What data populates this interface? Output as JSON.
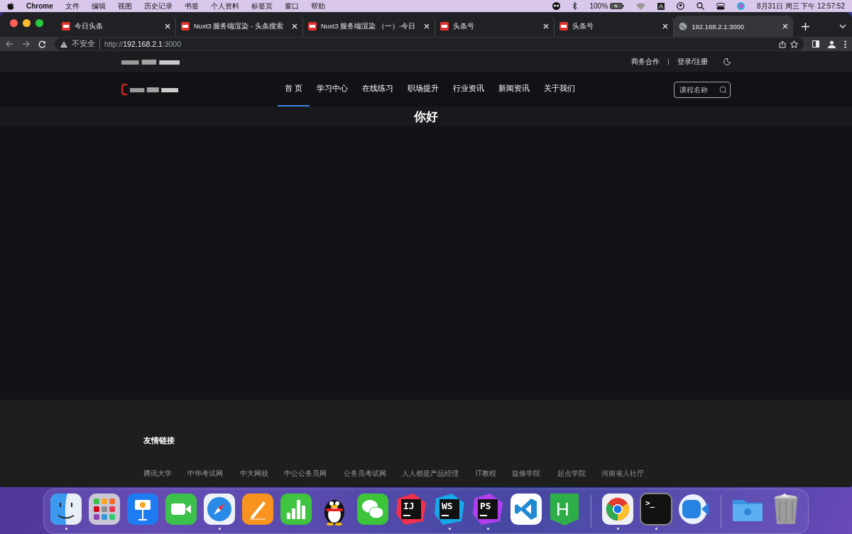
{
  "menu_bar": {
    "app": "Chrome",
    "menus": [
      "文件",
      "编辑",
      "视图",
      "历史记录",
      "书签",
      "个人资料",
      "标签页",
      "窗口",
      "帮助"
    ],
    "battery": "100%",
    "input_method": "A",
    "clock": "8月31日 周三 下午 12:57:52"
  },
  "tabs": [
    {
      "title": "今日头条",
      "kind": "site",
      "selected": false
    },
    {
      "title": "Nuxt3 服务端渲染 - 头条搜索",
      "kind": "site",
      "selected": false
    },
    {
      "title": "Nuxt3 服务端渲染 （一）-今日",
      "kind": "site",
      "selected": false
    },
    {
      "title": "头条号",
      "kind": "site",
      "selected": false
    },
    {
      "title": "头条号",
      "kind": "site",
      "selected": false
    },
    {
      "title": "192.168.2.1:3000",
      "kind": "local",
      "selected": true
    }
  ],
  "address_bar": {
    "security": "不安全",
    "scheme": "http://",
    "host": "192.168.2.1",
    "port": ":3000"
  },
  "site": {
    "top_links": [
      "商务合作",
      "登录/注册"
    ],
    "nav": [
      {
        "label": "首 页",
        "selected": true
      },
      {
        "label": "学习中心",
        "selected": false
      },
      {
        "label": "在线练习",
        "selected": false
      },
      {
        "label": "职场提升",
        "selected": false
      },
      {
        "label": "行业资讯",
        "selected": false
      },
      {
        "label": "新闻资讯",
        "selected": false
      },
      {
        "label": "关于我们",
        "selected": false
      }
    ],
    "search": {
      "placeholder": "课程名称"
    },
    "heading": "你好",
    "footer": {
      "title": "友情链接",
      "links": [
        "腾讯大学",
        "中华考试网",
        "中大网校",
        "中公公务员网",
        "公务员考试网",
        "人人都是产品经理",
        "IT教程",
        "益修学院",
        "起点学院",
        "河南省人社厅"
      ]
    }
  },
  "dock": [
    {
      "kind": "finder",
      "running": true
    },
    {
      "kind": "launchpad",
      "running": false
    },
    {
      "kind": "keynote",
      "running": false
    },
    {
      "kind": "facetime",
      "running": false
    },
    {
      "kind": "safari",
      "running": true
    },
    {
      "kind": "pages",
      "running": false
    },
    {
      "kind": "numbers",
      "running": false
    },
    {
      "kind": "penguin",
      "running": false
    },
    {
      "kind": "wechat",
      "running": false
    },
    {
      "kind": "jetbrains",
      "label": "IJ",
      "running": false
    },
    {
      "kind": "jetbrains",
      "label": "WS",
      "running": true
    },
    {
      "kind": "jetbrains",
      "label": "PS",
      "running": true
    },
    {
      "kind": "vscode",
      "running": false
    },
    {
      "kind": "hbuilder",
      "label": "H",
      "running": false
    },
    {
      "kind": "separator"
    },
    {
      "kind": "chrome",
      "running": true
    },
    {
      "kind": "terminal",
      "label": ">_",
      "running": true
    },
    {
      "kind": "zoom",
      "running": false
    },
    {
      "kind": "separator"
    },
    {
      "kind": "folder",
      "running": false
    },
    {
      "kind": "trash",
      "running": false
    }
  ]
}
